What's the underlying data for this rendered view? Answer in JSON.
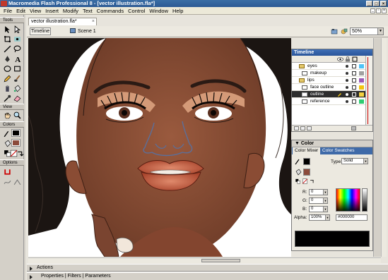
{
  "window": {
    "title": "Macromedia Flash Professional 8 - [vector illustration.fla*]"
  },
  "menu": [
    "File",
    "Edit",
    "View",
    "Insert",
    "Modify",
    "Text",
    "Commands",
    "Control",
    "Window",
    "Help"
  ],
  "tools_panel": {
    "title": "Tools",
    "view_label": "View",
    "colors_label": "Colors",
    "options_label": "Options"
  },
  "document": {
    "tab_label": "vector illustration.fla*",
    "timeline_button": "Timeline",
    "scene_label": "Scene 1",
    "zoom": "50%"
  },
  "timeline_panel": {
    "title": "Timeline",
    "layers": [
      {
        "name": "eyes",
        "color": "#4fc3f7",
        "selected": false
      },
      {
        "name": "makeup",
        "color": "#a0a0a0",
        "selected": false
      },
      {
        "name": "lips",
        "color": "#9b59b6",
        "selected": false
      },
      {
        "name": "face outline",
        "color": "#f1c40f",
        "selected": false
      },
      {
        "name": "outline",
        "color": "#f4d03f",
        "selected": true
      },
      {
        "name": "reference",
        "color": "#2ecc71",
        "selected": false
      }
    ]
  },
  "color_panel": {
    "title": "Color",
    "tabs": [
      "Color Mixer",
      "Color Swatches"
    ],
    "type_label": "Type:",
    "type_value": "Solid",
    "r_label": "R:",
    "r_value": "0",
    "g_label": "G:",
    "g_value": "0",
    "b_label": "B:",
    "b_value": "0",
    "alpha_label": "Alpha:",
    "alpha_value": "100%",
    "hex_value": "#000000"
  },
  "bottom_panels": {
    "actions": "Actions",
    "properties": "Properties",
    "filters": "Filters",
    "parameters": "Parameters"
  }
}
